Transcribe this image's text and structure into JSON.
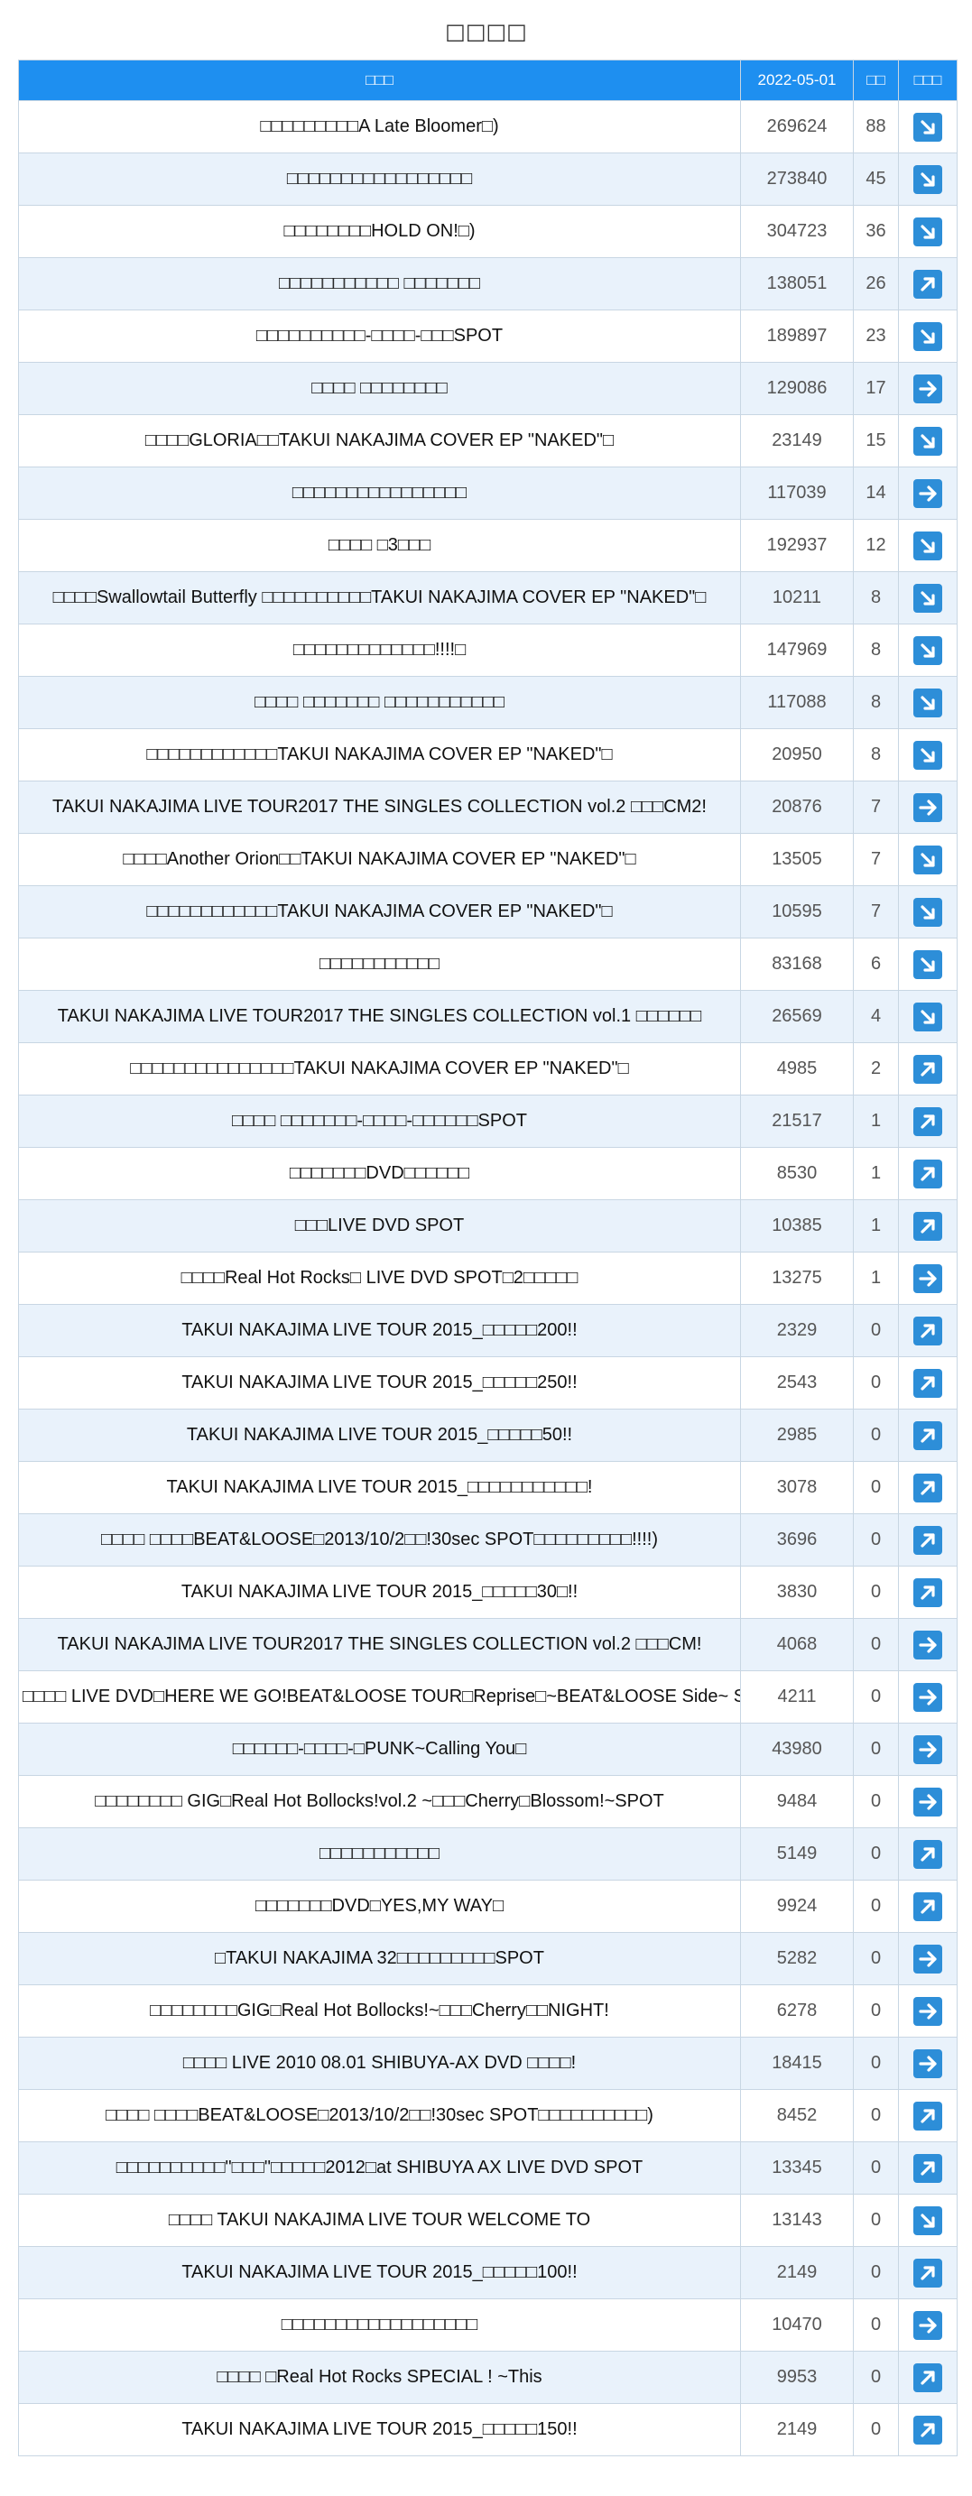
{
  "page": {
    "title": "□□□□"
  },
  "colors": {
    "header": "#1e8ff0",
    "stripe": "#e9f2fb",
    "icon": "#2d8ed8"
  },
  "table": {
    "headers": [
      "□□□",
      "2022-05-01",
      "□□",
      "□□□"
    ],
    "rows": [
      {
        "name": "□□□□□□□□□A Late Bloomer□)",
        "views": "269624",
        "change": "88",
        "trend": "down-right"
      },
      {
        "name": "□□□□□□□□□□□□□□□□□",
        "views": "273840",
        "change": "45",
        "trend": "down-right"
      },
      {
        "name": "□□□□□□□□HOLD ON!□)",
        "views": "304723",
        "change": "36",
        "trend": "down-right"
      },
      {
        "name": "□□□□□□□□□□□ □□□□□□□",
        "views": "138051",
        "change": "26",
        "trend": "up-right"
      },
      {
        "name": "□□□□□□□□□□-□□□□-□□□SPOT",
        "views": "189897",
        "change": "23",
        "trend": "down-right"
      },
      {
        "name": "□□□□ □□□□□□□□",
        "views": "129086",
        "change": "17",
        "trend": "right"
      },
      {
        "name": "□□□□GLORIA□□TAKUI NAKAJIMA COVER EP \"NAKED\"□",
        "views": "23149",
        "change": "15",
        "trend": "down-right"
      },
      {
        "name": "□□□□□□□□□□□□□□□□",
        "views": "117039",
        "change": "14",
        "trend": "right"
      },
      {
        "name": "□□□□ □3□□□",
        "views": "192937",
        "change": "12",
        "trend": "down-right"
      },
      {
        "name": "□□□□Swallowtail Butterfly □□□□□□□□□□TAKUI NAKAJIMA COVER EP \"NAKED\"□",
        "views": "10211",
        "change": "8",
        "trend": "down-right"
      },
      {
        "name": "□□□□□□□□□□□□□!!!!□",
        "views": "147969",
        "change": "8",
        "trend": "down-right"
      },
      {
        "name": "□□□□ □□□□□□□ □□□□□□□□□□□",
        "views": "117088",
        "change": "8",
        "trend": "down-right"
      },
      {
        "name": "□□□□□□□□□□□□TAKUI NAKAJIMA COVER EP \"NAKED\"□",
        "views": "20950",
        "change": "8",
        "trend": "down-right"
      },
      {
        "name": "TAKUI NAKAJIMA LIVE TOUR2017 THE SINGLES COLLECTION vol.2 □□□CM2!",
        "views": "20876",
        "change": "7",
        "trend": "right"
      },
      {
        "name": "□□□□Another Orion□□TAKUI NAKAJIMA COVER EP \"NAKED\"□",
        "views": "13505",
        "change": "7",
        "trend": "down-right"
      },
      {
        "name": "□□□□□□□□□□□□TAKUI NAKAJIMA COVER EP \"NAKED\"□",
        "views": "10595",
        "change": "7",
        "trend": "down-right"
      },
      {
        "name": "□□□□□□□□□□□",
        "views": "83168",
        "change": "6",
        "trend": "down-right"
      },
      {
        "name": "TAKUI NAKAJIMA LIVE TOUR2017 THE SINGLES COLLECTION vol.1 □□□□□□",
        "views": "26569",
        "change": "4",
        "trend": "down-right"
      },
      {
        "name": "□□□□□□□□□□□□□□□TAKUI NAKAJIMA COVER EP \"NAKED\"□",
        "views": "4985",
        "change": "2",
        "trend": "up-right"
      },
      {
        "name": "□□□□ □□□□□□□-□□□□-□□□□□□SPOT",
        "views": "21517",
        "change": "1",
        "trend": "up-right"
      },
      {
        "name": "□□□□□□□DVD□□□□□□",
        "views": "8530",
        "change": "1",
        "trend": "up-right"
      },
      {
        "name": "□□□LIVE DVD SPOT",
        "views": "10385",
        "change": "1",
        "trend": "up-right"
      },
      {
        "name": "□□□□Real Hot Rocks□ LIVE DVD SPOT□2□□□□□",
        "views": "13275",
        "change": "1",
        "trend": "right"
      },
      {
        "name": "TAKUI NAKAJIMA LIVE TOUR 2015_□□□□□200!!",
        "views": "2329",
        "change": "0",
        "trend": "up-right"
      },
      {
        "name": "TAKUI NAKAJIMA LIVE TOUR 2015_□□□□□250!!",
        "views": "2543",
        "change": "0",
        "trend": "up-right"
      },
      {
        "name": "TAKUI NAKAJIMA LIVE TOUR 2015_□□□□□50!!",
        "views": "2985",
        "change": "0",
        "trend": "up-right"
      },
      {
        "name": "TAKUI NAKAJIMA LIVE TOUR 2015_□□□□□□□□□□□!",
        "views": "3078",
        "change": "0",
        "trend": "up-right"
      },
      {
        "name": "□□□□ □□□□BEAT&LOOSE□2013/10/2□□!30sec SPOT□□□□□□□□□!!!!)",
        "views": "3696",
        "change": "0",
        "trend": "up-right"
      },
      {
        "name": "TAKUI NAKAJIMA LIVE TOUR 2015_□□□□□30□!!",
        "views": "3830",
        "change": "0",
        "trend": "up-right"
      },
      {
        "name": "TAKUI NAKAJIMA LIVE TOUR2017 THE SINGLES COLLECTION vol.2 □□□CM!",
        "views": "4068",
        "change": "0",
        "trend": "right"
      },
      {
        "name": "□□□□ LIVE DVD□HERE WE GO!BEAT&LOOSE TOUR□Reprise□~BEAT&LOOSE Side~ SPOT",
        "views": "4211",
        "change": "0",
        "trend": "right"
      },
      {
        "name": "□□□□□□-□□□□-□PUNK~Calling You□",
        "views": "43980",
        "change": "0",
        "trend": "right"
      },
      {
        "name": "□□□□□□□□ GIG□Real Hot Bollocks!vol.2 ~□□□Cherry□Blossom!~SPOT",
        "views": "9484",
        "change": "0",
        "trend": "right"
      },
      {
        "name": "□□□□□□□□□□□",
        "views": "5149",
        "change": "0",
        "trend": "up-right"
      },
      {
        "name": "□□□□□□□DVD□YES,MY WAY□",
        "views": "9924",
        "change": "0",
        "trend": "up-right"
      },
      {
        "name": "□TAKUI NAKAJIMA 32□□□□□□□□□SPOT",
        "views": "5282",
        "change": "0",
        "trend": "right"
      },
      {
        "name": "□□□□□□□□GIG□Real Hot Bollocks!~□□□Cherry□□NIGHT!",
        "views": "6278",
        "change": "0",
        "trend": "right"
      },
      {
        "name": "□□□□ LIVE 2010 08.01 SHIBUYA-AX DVD □□□□!",
        "views": "18415",
        "change": "0",
        "trend": "right"
      },
      {
        "name": "□□□□ □□□□BEAT&LOOSE□2013/10/2□□!30sec SPOT□□□□□□□□□□)",
        "views": "8452",
        "change": "0",
        "trend": "up-right"
      },
      {
        "name": "□□□□□□□□□□\"□□□\"□□□□□2012□at SHIBUYA AX LIVE DVD SPOT",
        "views": "13345",
        "change": "0",
        "trend": "up-right"
      },
      {
        "name": "□□□□ TAKUI NAKAJIMA LIVE TOUR WELCOME TO",
        "views": "13143",
        "change": "0",
        "trend": "down-right"
      },
      {
        "name": "TAKUI NAKAJIMA LIVE TOUR 2015_□□□□□100!!",
        "views": "2149",
        "change": "0",
        "trend": "up-right"
      },
      {
        "name": "□□□□□□□□□□□□□□□□□□",
        "views": "10470",
        "change": "0",
        "trend": "right"
      },
      {
        "name": "□□□□ □Real Hot Rocks SPECIAL ! ~This",
        "views": "9953",
        "change": "0",
        "trend": "up-right"
      },
      {
        "name": "TAKUI NAKAJIMA LIVE TOUR 2015_□□□□□150!!",
        "views": "2149",
        "change": "0",
        "trend": "up-right"
      }
    ]
  }
}
